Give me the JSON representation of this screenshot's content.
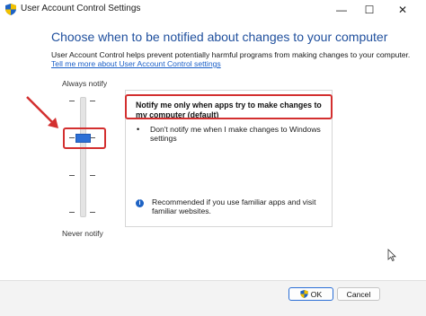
{
  "window": {
    "title": "User Account Control Settings",
    "controls": {
      "minimize": "—",
      "maximize": "☐",
      "close": "✕"
    }
  },
  "main": {
    "heading": "Choose when to be notified about changes to your computer",
    "description": "User Account Control helps prevent potentially harmful programs from making changes to your computer.",
    "help_link": "Tell me more about User Account Control settings"
  },
  "slider": {
    "top_label": "Always notify",
    "bottom_label": "Never notify",
    "levels": 4,
    "selected_level": 3
  },
  "panel": {
    "title": "Notify me only when apps try to make changes to my computer (default)",
    "bullet_char": "•",
    "bullet": "Don't notify me when I make changes to Windows settings",
    "info_glyph": "i",
    "recommendation": "Recommended if you use familiar apps and visit familiar websites."
  },
  "footer": {
    "ok_label": "OK",
    "cancel_label": "Cancel"
  },
  "colors": {
    "heading": "#1f4f9d",
    "link": "#1a5fc8",
    "thumb": "#2b6fd6",
    "annotation": "#d32f2f"
  },
  "icons": {
    "app": "uac-shield-icon",
    "ok_button": "uac-shield-icon",
    "info": "info-icon",
    "annotation": "arrow-icon"
  }
}
